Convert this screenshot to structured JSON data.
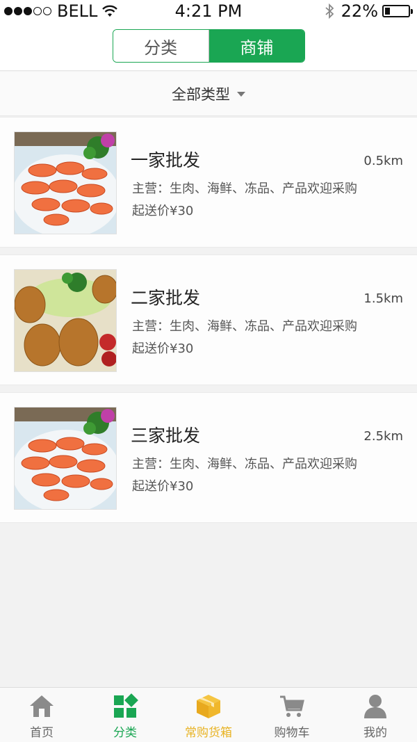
{
  "status_bar": {
    "carrier": "BELL",
    "time": "4:21 PM",
    "battery": "22%",
    "battery_level": 0.22,
    "signal_bars_filled": 3,
    "signal_bars_total": 5
  },
  "segment": {
    "tabs": [
      {
        "label": "分类",
        "active": false
      },
      {
        "label": "商铺",
        "active": true
      }
    ]
  },
  "filter": {
    "label": "全部类型",
    "icon": "caret-down-icon"
  },
  "shops": [
    {
      "name": "一家批发",
      "distance": "0.5km",
      "main": "主营：生肉、海鲜、冻品、产品欢迎采购",
      "min_order": "起送价¥30",
      "image": "shrimp-photo"
    },
    {
      "name": "二家批发",
      "distance": "1.5km",
      "main": "主营：生肉、海鲜、冻品、产品欢迎采购",
      "min_order": "起送价¥30",
      "image": "fried-chicken-photo"
    },
    {
      "name": "三家批发",
      "distance": "2.5km",
      "main": "主营：生肉、海鲜、冻品、产品欢迎采购",
      "min_order": "起送价¥30",
      "image": "shrimp-photo"
    }
  ],
  "tab_bar": {
    "items": [
      {
        "label": "首页",
        "icon": "home-icon"
      },
      {
        "label": "分类",
        "icon": "category-icon"
      },
      {
        "label": "常购货箱",
        "icon": "box-icon"
      },
      {
        "label": "购物车",
        "icon": "cart-icon"
      },
      {
        "label": "我的",
        "icon": "user-icon"
      }
    ]
  },
  "colors": {
    "accent": "#1aa653",
    "highlight": "#e8b324",
    "background": "#f2f2f2"
  }
}
